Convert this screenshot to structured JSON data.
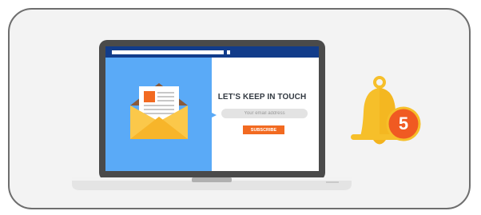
{
  "newsletter": {
    "headline": "LET'S KEEP IN TOUCH",
    "email_placeholder": "Your email address",
    "subscribe_label": "SUBSCRIBE"
  },
  "notification": {
    "count": "5"
  },
  "icons": {
    "envelope": "envelope-letter-icon",
    "bell": "bell-icon",
    "laptop": "laptop-icon"
  },
  "colors": {
    "card_background": "#f3f3f3",
    "card_border": "#6e6e6e",
    "screen_left": "#5aaaf7",
    "browser_bar": "#123c8a",
    "subscribe_button": "#f26a21",
    "bell_yellow": "#f6bf2a",
    "badge_orange": "#f05a22",
    "envelope_yellow": "#f7b52a"
  }
}
